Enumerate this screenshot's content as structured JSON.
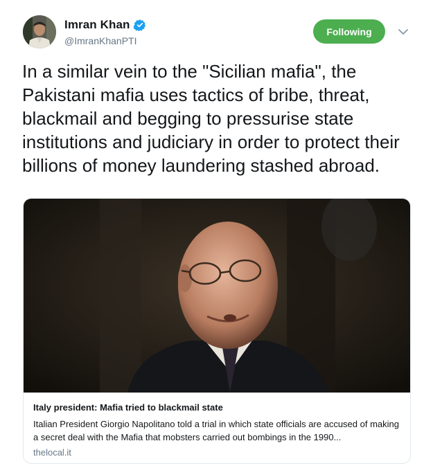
{
  "user": {
    "display_name": "Imran Khan",
    "handle": "@ImranKhanPTI",
    "verified": true
  },
  "actions": {
    "follow_label": "Following",
    "follow_color": "#4cae4f"
  },
  "tweet": {
    "text": "In a similar vein to the \"Sicilian mafia\", the Pakistani mafia uses tactics of bribe, threat, blackmail and begging to pressurise state institutions and judiciary in order to protect their billions of money laundering stashed abroad."
  },
  "card": {
    "title": "Italy president: Mafia tried to blackmail state",
    "description": "Italian President Giorgio Napolitano told a trial in which state officials are accused of making a secret deal with the Mafia that mobsters carried out bombings in the 1990...",
    "domain": "thelocal.it"
  },
  "colors": {
    "text": "#14171a",
    "secondary_text": "#657786",
    "verified_blue": "#1da1f2",
    "border": "#e1e8ed"
  }
}
